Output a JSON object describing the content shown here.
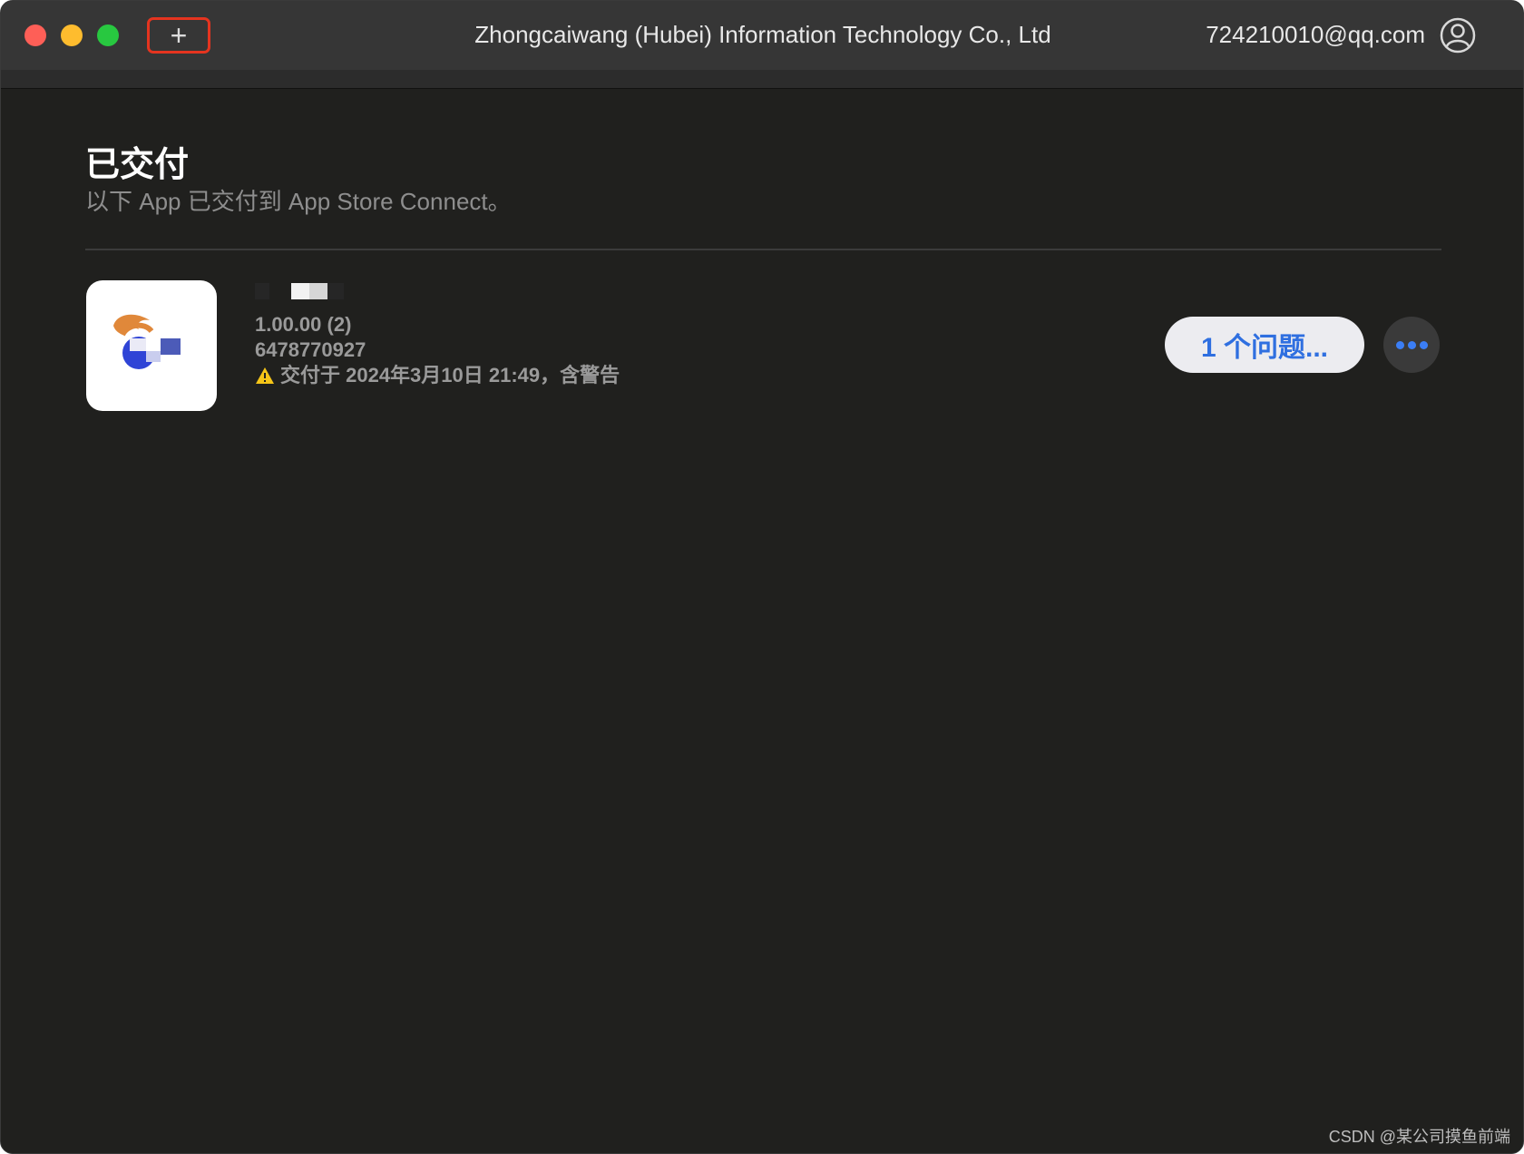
{
  "window": {
    "title": "Zhongcaiwang (Hubei) Information Technology Co., Ltd",
    "account": "724210010@qq.com",
    "add_label": "+"
  },
  "page": {
    "heading": "已交付",
    "subheading": "以下 App 已交付到 App Store Connect。"
  },
  "app": {
    "version": "1.00.00 (2)",
    "build_id": "6478770927",
    "status": "交付于 2024年3月10日 21:49，含警告",
    "issues_label": "1 个问题..."
  },
  "watermark": "CSDN @某公司摸鱼前端",
  "icons": {
    "account": "person-circle-icon",
    "warning": "warning-triangle-icon",
    "more": "ellipsis-icon"
  },
  "colors": {
    "accent": "#2f6fe0",
    "window_bg": "#20201e",
    "titlebar_bg": "#363636",
    "highlight_border": "#e5341f",
    "warning": "#f5c518"
  }
}
